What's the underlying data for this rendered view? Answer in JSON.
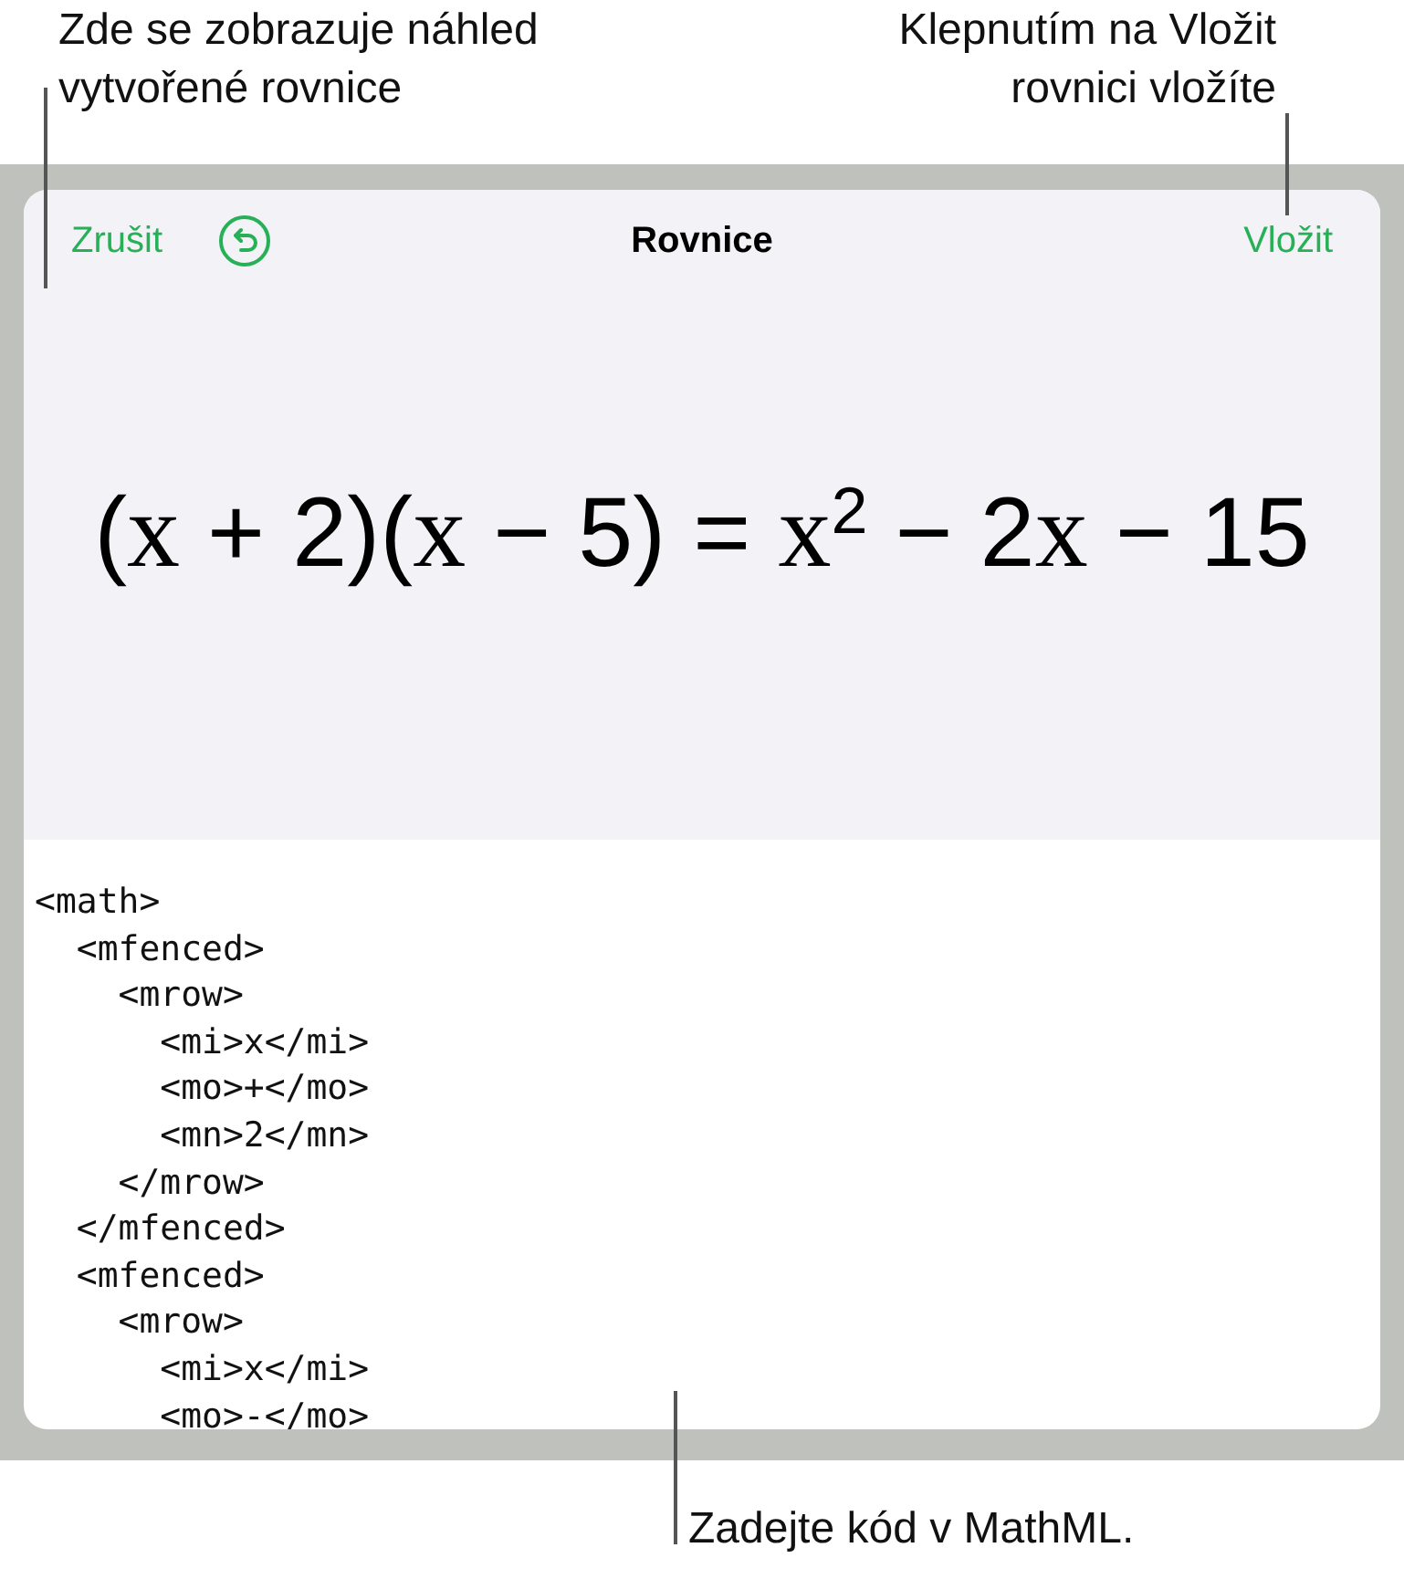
{
  "callouts": {
    "preview": "Zde se zobrazuje náhled vytvořené rovnice",
    "insert": "Klepnutím na Vložit rovnici vložíte",
    "code": "Zadejte kód v MathML."
  },
  "toolbar": {
    "cancel": "Zrušit",
    "title": "Rovnice",
    "insert": "Vložit"
  },
  "equation": [
    {
      "kind": "text",
      "text": "("
    },
    {
      "kind": "variable",
      "text": "x"
    },
    {
      "kind": "text",
      "text": " + 2)("
    },
    {
      "kind": "variable",
      "text": "x"
    },
    {
      "kind": "text",
      "text": " − 5) = "
    },
    {
      "kind": "variable",
      "text": "x"
    },
    {
      "kind": "superscript",
      "text": "2"
    },
    {
      "kind": "text",
      "text": " − 2"
    },
    {
      "kind": "variable",
      "text": "x"
    },
    {
      "kind": "text",
      "text": " − 15"
    }
  ],
  "code_lines": [
    "<math>",
    "  <mfenced>",
    "    <mrow>",
    "      <mi>x</mi>",
    "      <mo>+</mo>",
    "      <mn>2</mn>",
    "    </mrow>",
    "  </mfenced>",
    "  <mfenced>",
    "    <mrow>",
    "      <mi>x</mi>",
    "      <mo>-</mo>"
  ]
}
